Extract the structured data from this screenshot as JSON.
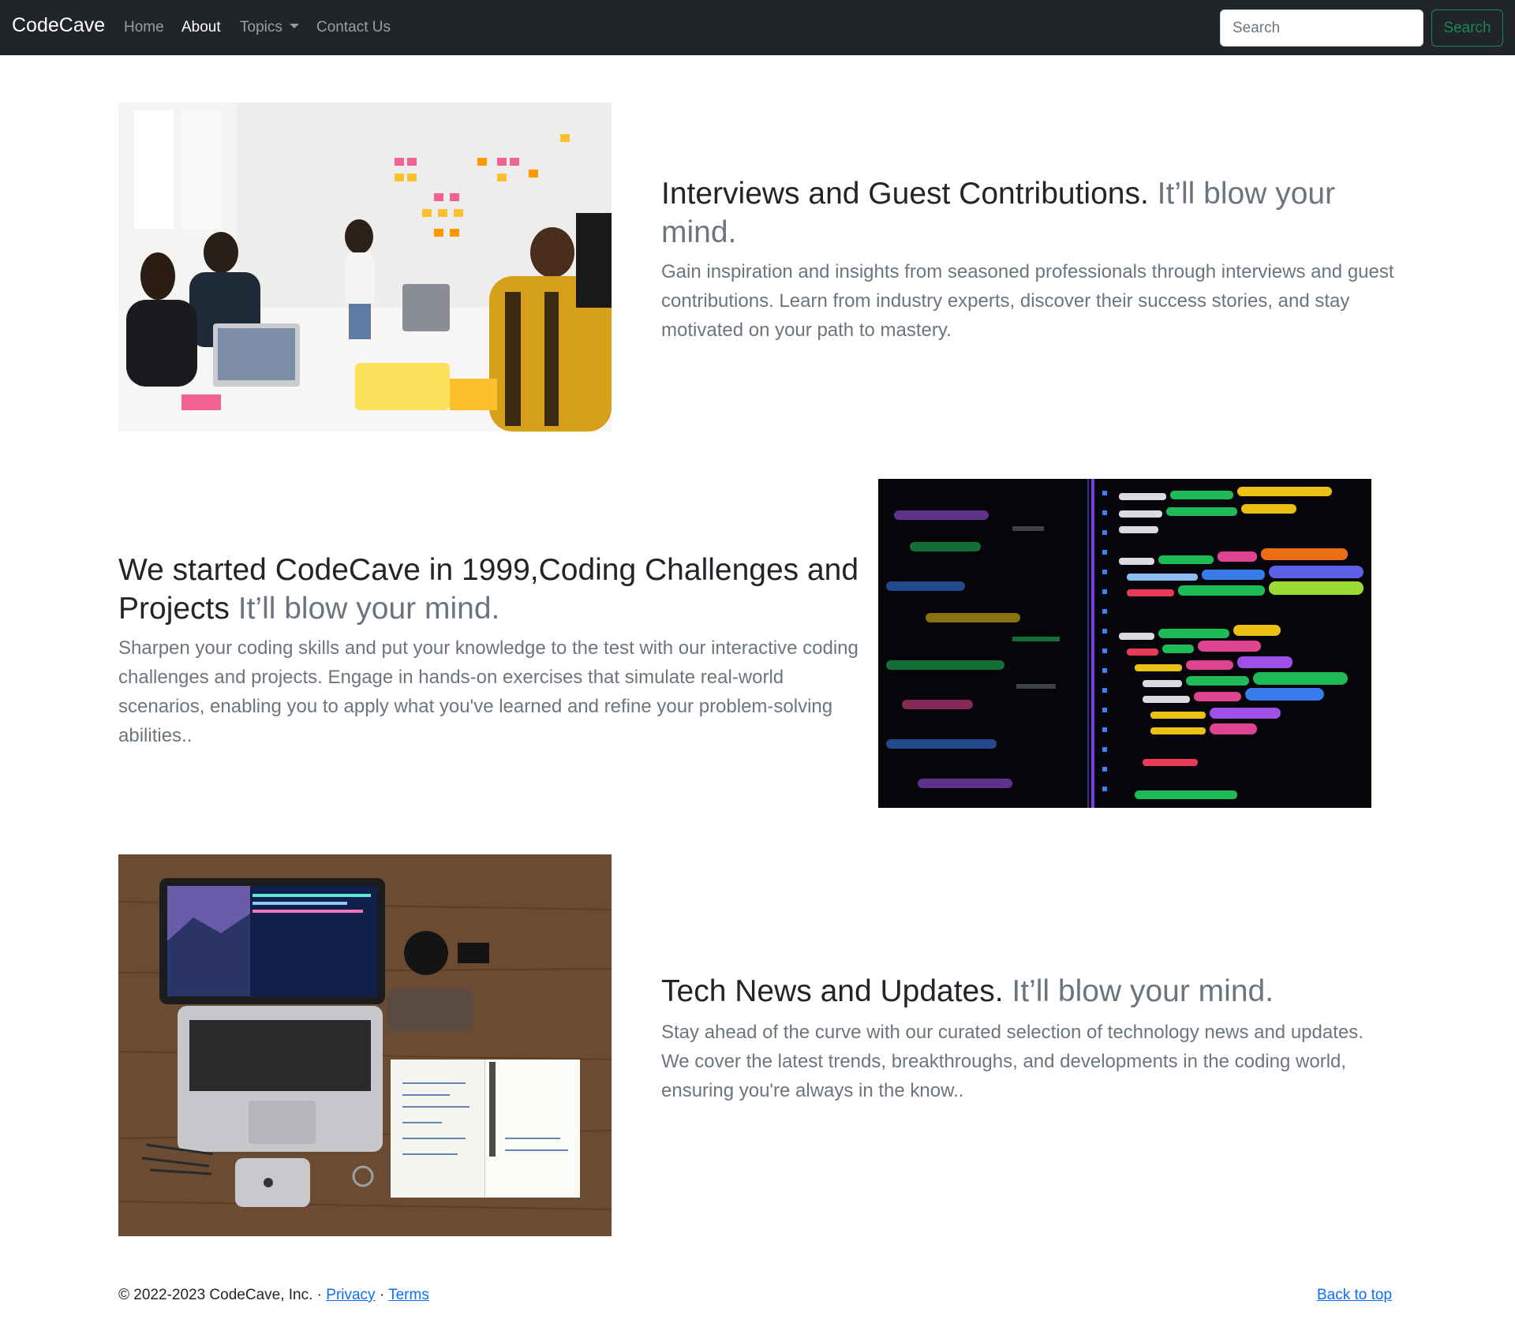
{
  "navbar": {
    "brand": "CodeCave",
    "links": [
      "Home",
      "About",
      "Topics",
      "Contact Us"
    ],
    "search_placeholder": "Search",
    "search_button": "Search"
  },
  "features": [
    {
      "heading": "Interviews and Guest Contributions.",
      "heading_muted": "It’ll blow your mind.",
      "text": "Gain inspiration and insights from seasoned professionals through interviews and guest contributions. Learn from industry experts, discover their success stories, and stay motivated on your path to mastery.",
      "image": "team-meeting-photo"
    },
    {
      "heading": "We started CodeCave in 1999,Coding Challenges and Projects",
      "heading_muted": "It’ll blow your mind.",
      "text": "Sharpen your coding skills and put your knowledge to the test with our interactive coding challenges and projects. Engage in hands-on exercises that simulate real-world scenarios, enabling you to apply what you've learned and refine your problem-solving abilities..",
      "image": "code-screen-photo"
    },
    {
      "heading": "Tech News and Updates.",
      "heading_muted": "It’ll blow your mind.",
      "text": "Stay ahead of the curve with our curated selection of technology news and updates. We cover the latest trends, breakthroughs, and developments in the coding world, ensuring you're always in the know..",
      "image": "laptop-desk-photo"
    }
  ],
  "footer": {
    "copyright": "© 2022-2023 CodeCave, Inc. ·",
    "privacy": "Privacy",
    "separator": "·",
    "terms": "Terms",
    "back_to_top": "Back to top"
  },
  "colors": {
    "navbar_bg": "#212529",
    "success": "#198754",
    "link": "#0d6efd",
    "muted": "#6c757d"
  }
}
